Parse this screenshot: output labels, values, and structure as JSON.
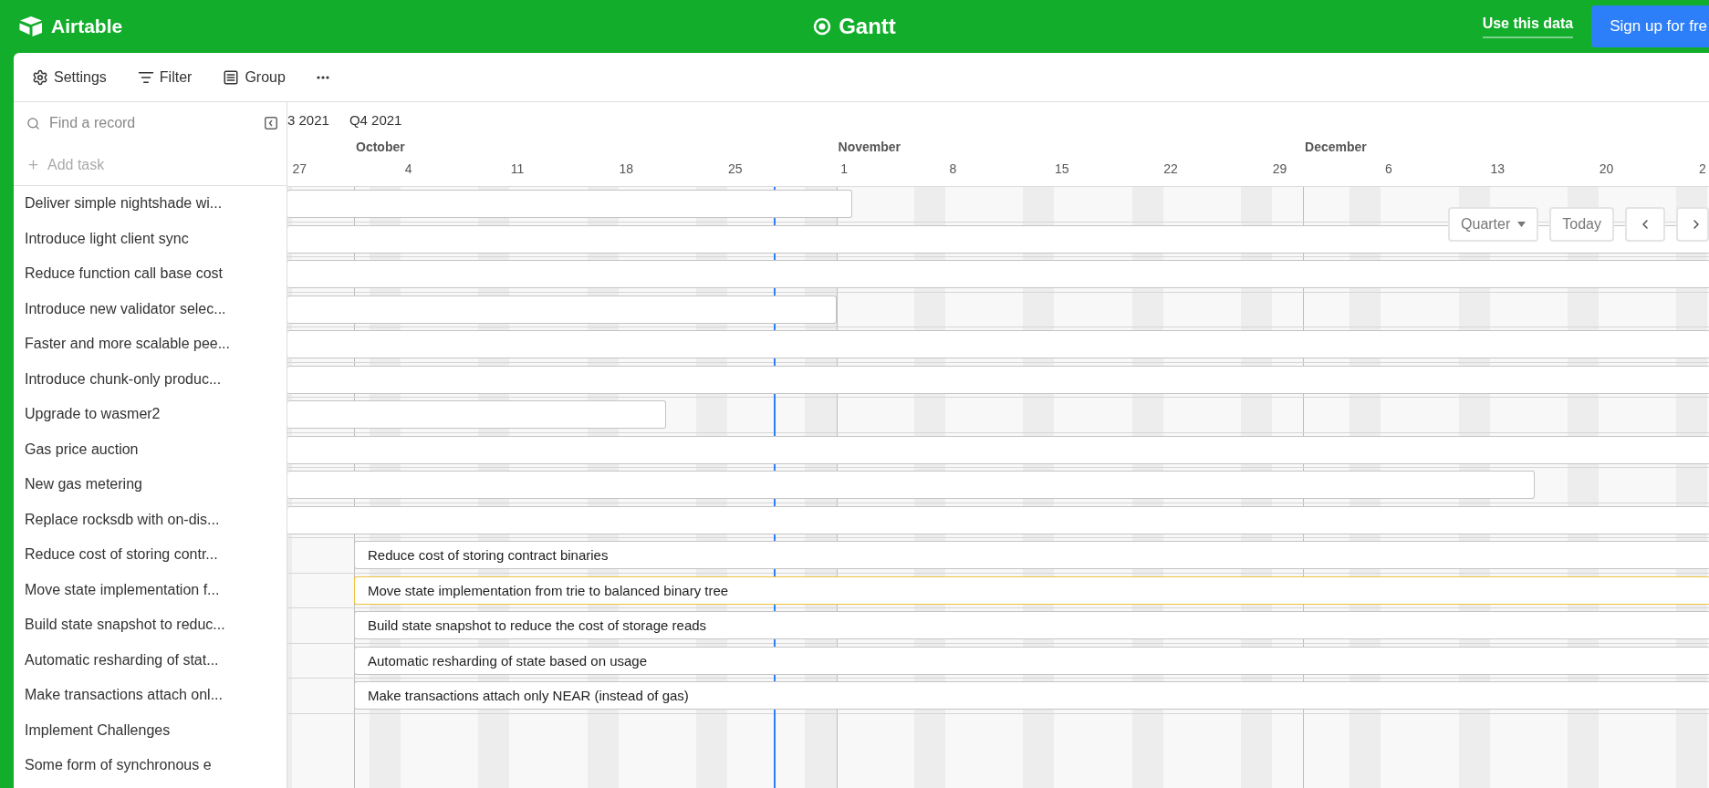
{
  "top_bar": {
    "logo": "Airtable",
    "title": "Gantt",
    "use_data": "Use this data",
    "signup": "Sign up for fre"
  },
  "toolbar": [
    {
      "kind": "settings",
      "label": "Settings"
    },
    {
      "kind": "filter",
      "label": "Filter"
    },
    {
      "kind": "group",
      "label": "Group"
    },
    {
      "kind": "more"
    }
  ],
  "sidebar": {
    "search_placeholder": "Find a record",
    "add_task": "Add task",
    "records": [
      "Deliver simple nightshade wi...",
      "Introduce light client sync",
      "Reduce function call base cost",
      "Introduce new validator selec...",
      "Faster and more scalable pee...",
      "Introduce chunk-only produc...",
      "Upgrade to wasmer2",
      "Gas price auction",
      "New gas metering",
      "Replace rocksdb with on-dis...",
      "Reduce cost of storing contr...",
      "Move state implementation f...",
      "Build state snapshot to reduc...",
      "Automatic resharding of stat...",
      "Make transactions attach onl...",
      "Implement Challenges",
      "Some form of synchronous e"
    ]
  },
  "timeline": {
    "quarters": [
      "3 2021",
      "Q4 2021"
    ],
    "months": [
      "October",
      "November",
      "December"
    ],
    "days": [
      "27",
      "4",
      "11",
      "18",
      "25",
      "1",
      "8",
      "15",
      "22",
      "29",
      "6",
      "13",
      "20",
      "2"
    ],
    "controls": {
      "scale": "Quarter",
      "today": "Today"
    },
    "bars": [
      {
        "kind": "continued",
        "level": 0.397,
        "selected": false
      },
      {
        "kind": "continued",
        "level": 1,
        "selected": false
      },
      {
        "kind": "continued",
        "level": 1,
        "selected": false
      },
      {
        "kind": "continued",
        "level": 0.386,
        "selected": false
      },
      {
        "kind": "continued",
        "level": 1,
        "selected": false
      },
      {
        "kind": "continued",
        "level": 1,
        "selected": false
      },
      {
        "kind": "continued",
        "level": 0.266,
        "selected": false
      },
      {
        "kind": "continued",
        "level": 1,
        "selected": false
      },
      {
        "kind": "continued",
        "level": 0.877,
        "selected": false
      },
      {
        "kind": "continued",
        "level": 1,
        "selected": false
      },
      {
        "kind": "new",
        "label": "Reduce cost of storing contract binaries",
        "level": 1,
        "selected": false
      },
      {
        "kind": "new",
        "label": "Move state implementation from trie to balanced binary tree",
        "level": 1,
        "selected": true
      },
      {
        "kind": "new",
        "label": "Build state snapshot to reduce the cost of storage reads",
        "level": 1,
        "selected": false
      },
      {
        "kind": "new",
        "label": "Automatic resharding of state based on usage",
        "level": 1,
        "selected": false
      },
      {
        "kind": "new",
        "label": "Make transactions attach only NEAR (instead of gas)",
        "level": 1,
        "selected": false
      }
    ]
  }
}
